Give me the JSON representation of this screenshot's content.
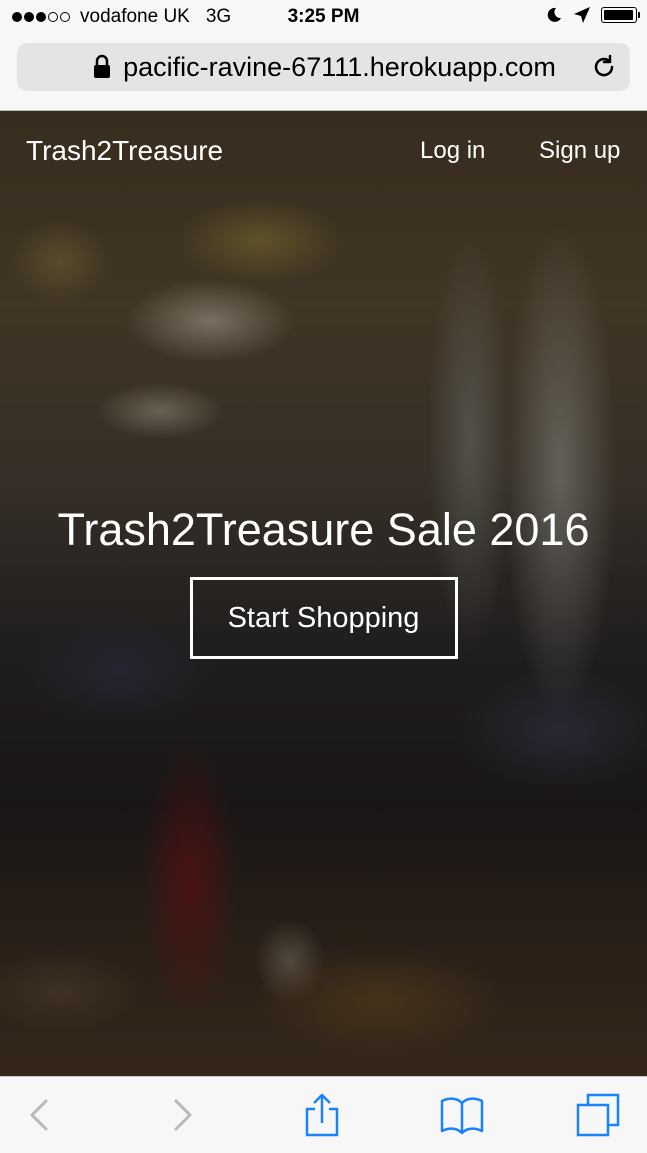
{
  "status_bar": {
    "carrier": "vodafone UK",
    "network": "3G",
    "time": "3:25 PM",
    "signal_strength_of_5": 3,
    "battery_level_percent": 95
  },
  "browser": {
    "url": "pacific-ravine-67111.herokuapp.com"
  },
  "nav": {
    "brand": "Trash2Treasure",
    "login": "Log in",
    "signup": "Sign up"
  },
  "hero": {
    "title": "Trash2Treasure Sale 2016",
    "cta": "Start Shopping"
  },
  "toolbar": {
    "back_icon": "chevron-left",
    "forward_icon": "chevron-right",
    "share_icon": "share",
    "bookmarks_icon": "open-book",
    "tabs_icon": "overlapping-squares"
  },
  "colors": {
    "ios_blue": "#1a82fb",
    "disabled_gray": "#b8b8bd"
  }
}
